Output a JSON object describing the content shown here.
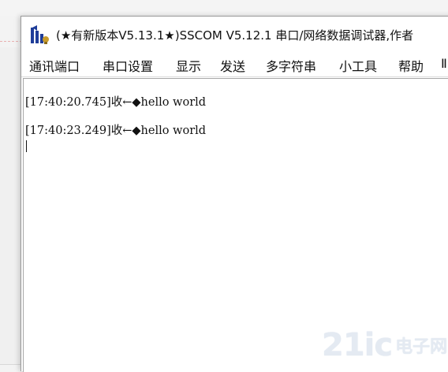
{
  "window": {
    "title": "(★有新版本V5.13.1★)SSCOM V5.12.1 串口/网络数据调试器,作者"
  },
  "menu": {
    "items": [
      "通讯端口",
      "串口设置",
      "显示",
      "发送",
      "多字符串",
      "小工具",
      "帮助",
      "Ⅱ"
    ]
  },
  "receive": {
    "lines": [
      "[17:40:20.745]收←◆hello world",
      "[17:40:23.249]收←◆hello world"
    ]
  },
  "watermark": {
    "number": "21ic",
    "text": "电子网"
  },
  "colors": {
    "icon_blue": "#1f3d99",
    "icon_gold": "#c89b2a",
    "window_bg": "#ffffff",
    "desktop_bg": "#f3f3f3"
  }
}
